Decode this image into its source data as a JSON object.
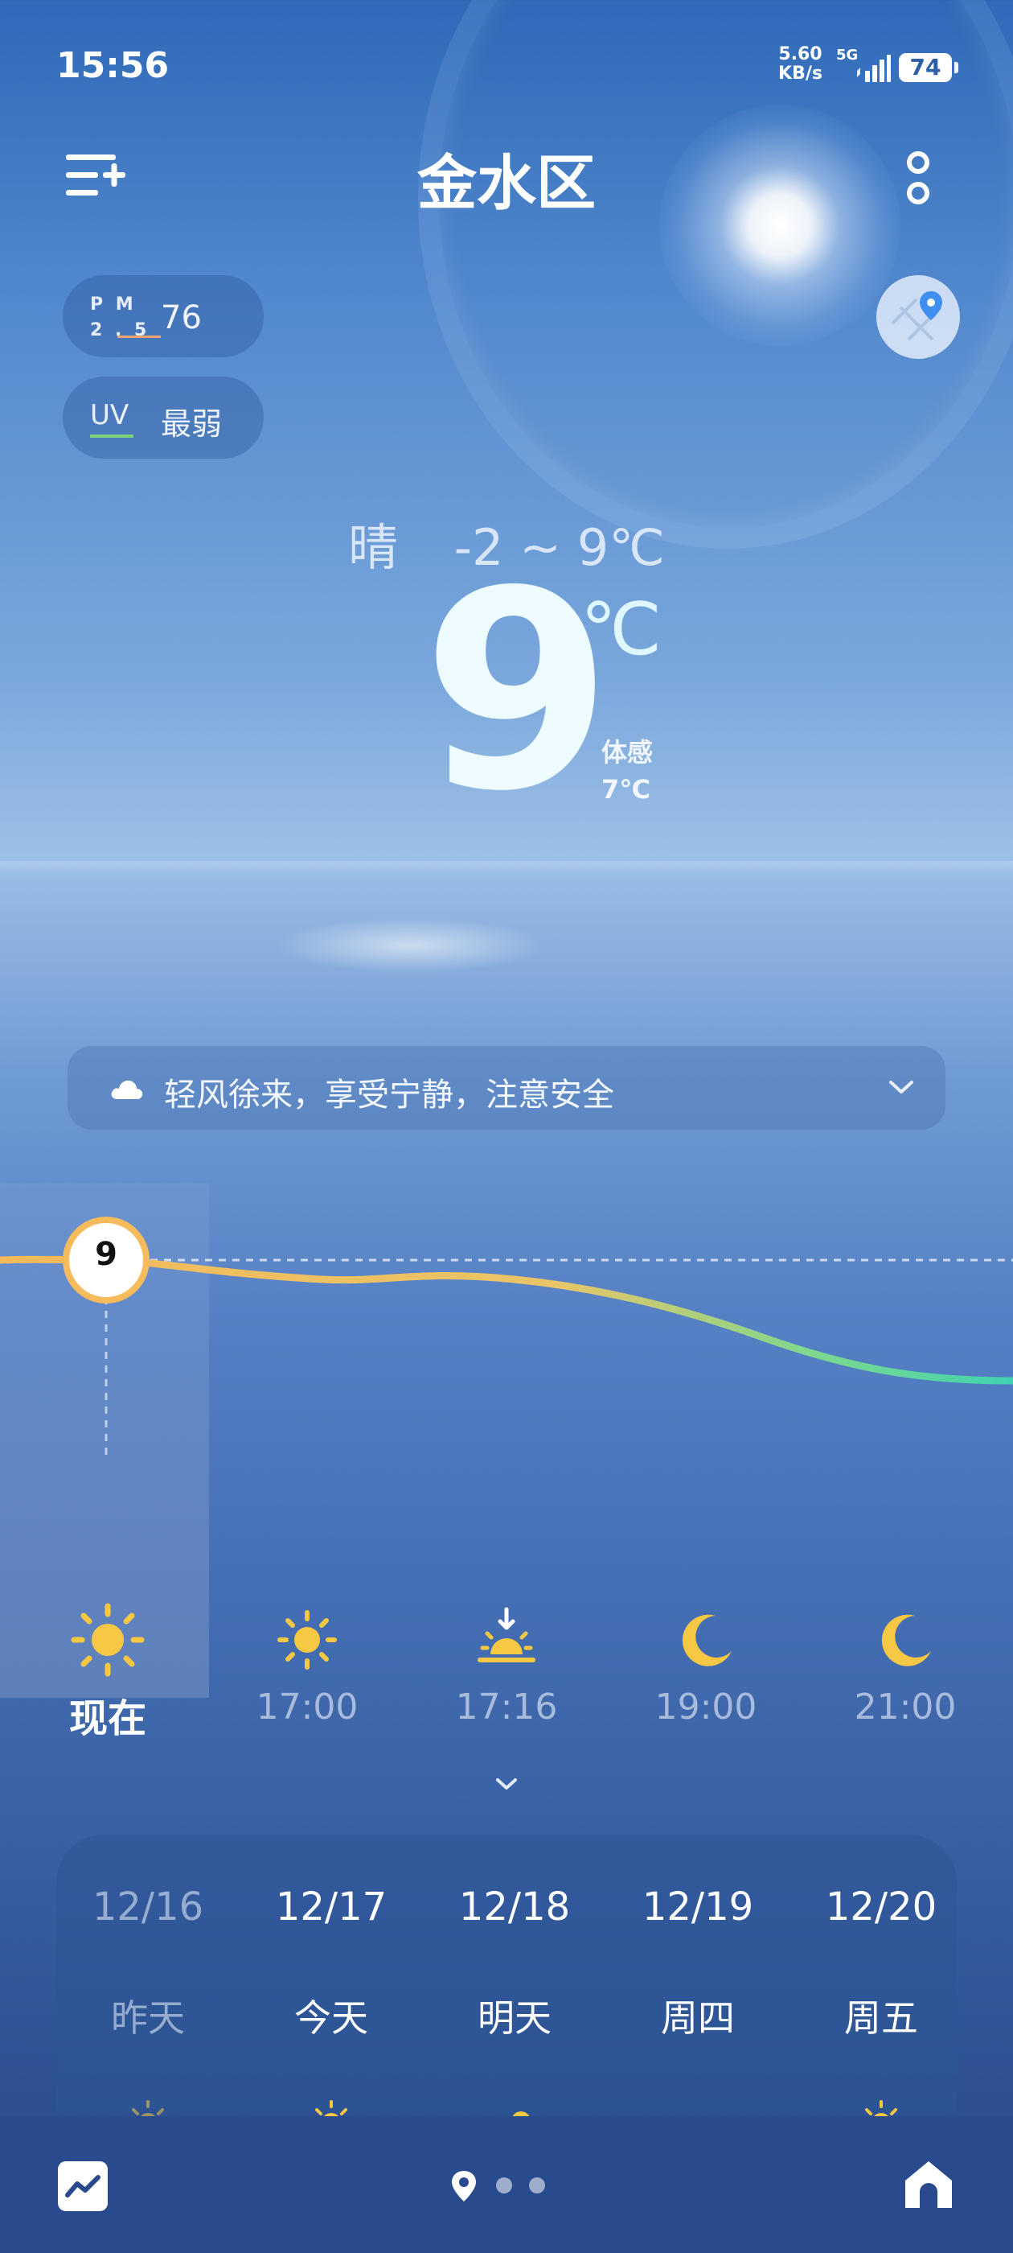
{
  "status_bar": {
    "time": "15:56",
    "net_speed_value": "5.60",
    "net_speed_unit": "KB/s",
    "network": "5G",
    "battery": "74"
  },
  "header": {
    "title": "金水区"
  },
  "air": {
    "pm_label_top": "P M",
    "pm_label_bottom": "2 . 5",
    "pm_value": "76",
    "uv_label": "UV",
    "uv_value": "最弱"
  },
  "current": {
    "condition": "晴",
    "range": "-2 ~ 9℃",
    "temperature": "9",
    "unit": "℃",
    "feels_label": "体感",
    "feels_value": "7℃"
  },
  "tip": {
    "text": "轻风徐来，享受宁静，注意安全"
  },
  "hourly": {
    "marker_value": "9",
    "items": [
      {
        "label": "现在",
        "icon": "sun-icon"
      },
      {
        "label": "17:00",
        "icon": "sun-icon"
      },
      {
        "label": "17:16",
        "icon": "sunset-icon"
      },
      {
        "label": "19:00",
        "icon": "moon-icon"
      },
      {
        "label": "21:00",
        "icon": "moon-icon"
      }
    ]
  },
  "daily": {
    "items": [
      {
        "date": "12/16",
        "name": "昨天",
        "icon": "sun-icon"
      },
      {
        "date": "12/17",
        "name": "今天",
        "icon": "sun-icon"
      },
      {
        "date": "12/18",
        "name": "明天",
        "icon": "partly-cloudy-icon"
      },
      {
        "date": "12/19",
        "name": "周四",
        "icon": "cloud-icon"
      },
      {
        "date": "12/20",
        "name": "周五",
        "icon": "sun-icon"
      }
    ]
  },
  "colors": {
    "sun_yellow": "#f7c843",
    "temp_line_warm": "#f3b95a",
    "temp_line_cool": "#3fd2b0",
    "big_temp": "#eefcff"
  }
}
